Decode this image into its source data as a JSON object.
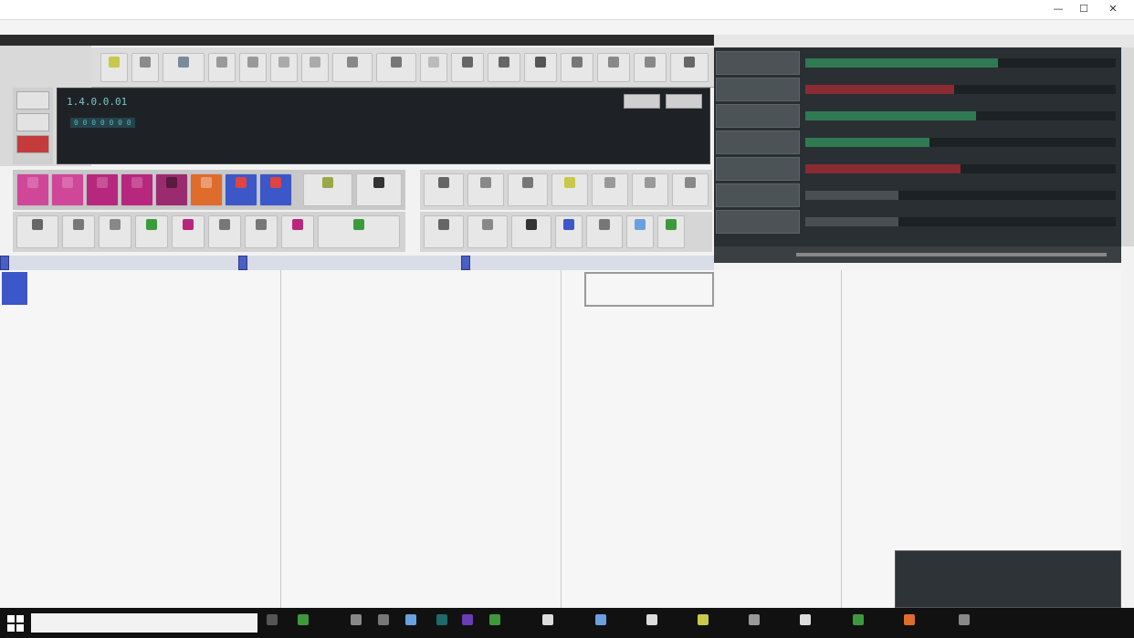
{
  "window": {
    "title": ""
  },
  "menu": [],
  "toolstrip": [],
  "panel_tabs": [],
  "display": {
    "line1": "1.4.0.0.01",
    "line2": "0 0 0 0 0 0 0",
    "line3": "",
    "btn1": "",
    "btn2": ""
  },
  "mixer": {
    "tracks": [
      {
        "color": "#2f7a52",
        "fill": 0.62
      },
      {
        "color": "#8a2a32",
        "fill": 0.48
      },
      {
        "color": "#2f7a52",
        "fill": 0.55
      },
      {
        "color": "#2f7a52",
        "fill": 0.4
      },
      {
        "color": "#8a2a32",
        "fill": 0.5
      },
      {
        "color": "#4a4f52",
        "fill": 0.3
      },
      {
        "color": "#4a4f52",
        "fill": 0.3
      }
    ]
  },
  "editor": {
    "columns": 4
  },
  "taskbar": {
    "search_placeholder": ""
  },
  "colors": {
    "pink": "#d0479a",
    "magenta": "#b8277e",
    "orange": "#e06c2c",
    "blue": "#3b57c8",
    "green": "#3c9a3c",
    "yellow": "#c8c84a"
  }
}
